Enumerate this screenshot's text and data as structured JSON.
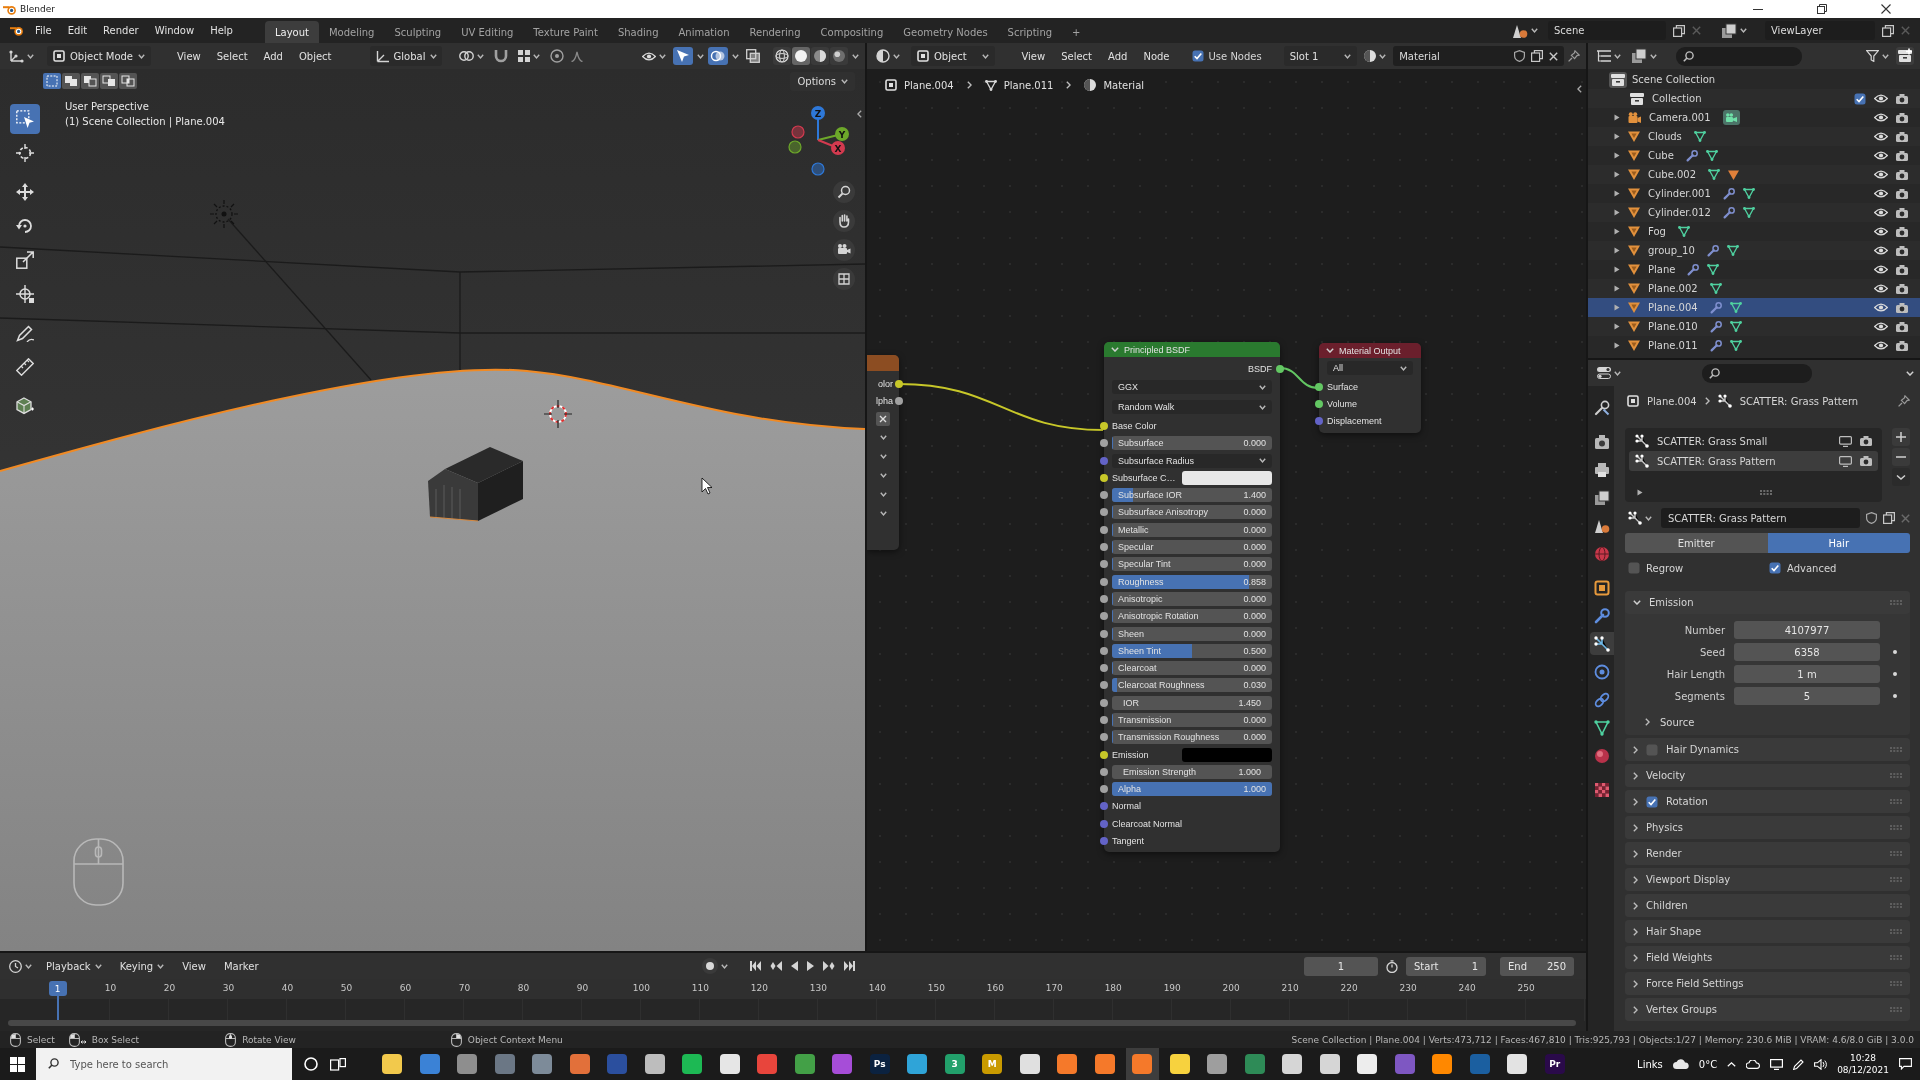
{
  "window": {
    "title": "Blender"
  },
  "topbar": {
    "menus": [
      "File",
      "Edit",
      "Render",
      "Window",
      "Help"
    ],
    "workspaces": [
      {
        "label": "Layout",
        "selected": true
      },
      {
        "label": "Modeling",
        "selected": false
      },
      {
        "label": "Sculpting",
        "selected": false
      },
      {
        "label": "UV Editing",
        "selected": false
      },
      {
        "label": "Texture Paint",
        "selected": false
      },
      {
        "label": "Shading",
        "selected": false
      },
      {
        "label": "Animation",
        "selected": false
      },
      {
        "label": "Rendering",
        "selected": false
      },
      {
        "label": "Compositing",
        "selected": false
      },
      {
        "label": "Geometry Nodes",
        "selected": false
      },
      {
        "label": "Scripting",
        "selected": false
      }
    ],
    "add_workspace": "+",
    "scene": "Scene",
    "view_layer": "ViewLayer"
  },
  "viewport": {
    "mode": "Object Mode",
    "menus": [
      "View",
      "Select",
      "Add",
      "Object"
    ],
    "orientation": "Global",
    "snap": false,
    "proportional": false,
    "gizmos": true,
    "overlays": true,
    "xray": false,
    "shading": [
      {
        "selected": false
      },
      {
        "selected": true
      },
      {
        "selected": false
      },
      {
        "selected": false
      }
    ],
    "select_modes": [
      {
        "selected": true
      },
      {
        "selected": false
      },
      {
        "selected": false
      },
      {
        "selected": false
      },
      {
        "selected": false
      }
    ],
    "options": "Options",
    "info": [
      "User Perspective",
      "(1) Scene Collection | Plane.004"
    ],
    "tools": [
      {
        "selected": true
      },
      {
        "selected": false
      },
      {
        "selected": false
      },
      {
        "selected": false
      },
      {
        "selected": false
      },
      {
        "selected": false
      },
      {
        "selected": false
      },
      {
        "selected": false
      },
      {
        "selected": false
      }
    ],
    "gizmo_axes": [
      {
        "label": "Z",
        "color": "#2e78d8"
      },
      {
        "label": "Y",
        "color": "#6da82a"
      },
      {
        "label": "X",
        "color": "#d33a4f"
      }
    ],
    "plane_selected": true
  },
  "node_editor": {
    "object": "Object",
    "menus": [
      "View",
      "Select",
      "Add",
      "Node"
    ],
    "use_nodes": {
      "label": "Use Nodes",
      "checked": true
    },
    "slot": "Slot 1",
    "material": "Material",
    "breadcrumb": [
      {
        "label": "Plane.004",
        "kind": "object"
      },
      {
        "label": "Plane.011",
        "kind": "mesh"
      },
      {
        "label": "Material",
        "kind": "material"
      }
    ],
    "texture_node": {
      "outputs": [
        {
          "label": "olor",
          "color": "#c7c729"
        },
        {
          "label": "lpha",
          "color": "#a1a1a1"
        }
      ]
    },
    "bsdf_node": {
      "title": "Principled BSDF",
      "output": {
        "label": "BSDF",
        "color": "#63c763"
      },
      "dropdowns": [
        "GGX",
        "Random Walk"
      ],
      "inputs": [
        {
          "label": "Base Color",
          "kind": "socket",
          "color": "#c7c729"
        },
        {
          "label": "Subsurface",
          "kind": "slider",
          "value": "0.000",
          "level": 0,
          "color": "#a1a1a1"
        },
        {
          "label": "Subsurface Radius",
          "kind": "menu",
          "color": "#6363c7"
        },
        {
          "label": "Subsurface C…",
          "kind": "swatch",
          "swatch": {
            "color": "#e8e8e8"
          },
          "color": "#c7c729"
        },
        {
          "label": "Subsurface IOR",
          "kind": "slider",
          "value": "1.400",
          "level": 0.13,
          "color": "#a1a1a1"
        },
        {
          "label": "Subsurface Anisotropy",
          "kind": "slider",
          "value": "0.000",
          "level": 0,
          "color": "#a1a1a1"
        },
        {
          "label": "Metallic",
          "kind": "slider",
          "value": "0.000",
          "level": 0,
          "color": "#a1a1a1"
        },
        {
          "label": "Specular",
          "kind": "slider",
          "value": "0.000",
          "level": 0,
          "color": "#a1a1a1"
        },
        {
          "label": "Specular Tint",
          "kind": "slider",
          "value": "0.000",
          "level": 0,
          "color": "#a1a1a1"
        },
        {
          "label": "Roughness",
          "kind": "slider",
          "value": "0.858",
          "level": 0.858,
          "color": "#a1a1a1"
        },
        {
          "label": "Anisotropic",
          "kind": "slider",
          "value": "0.000",
          "level": 0,
          "color": "#a1a1a1"
        },
        {
          "label": "Anisotropic Rotation",
          "kind": "slider",
          "value": "0.000",
          "level": 0,
          "color": "#a1a1a1"
        },
        {
          "label": "Sheen",
          "kind": "slider",
          "value": "0.000",
          "level": 0,
          "color": "#a1a1a1"
        },
        {
          "label": "Sheen Tint",
          "kind": "slider",
          "value": "0.500",
          "level": 0.5,
          "color": "#a1a1a1"
        },
        {
          "label": "Clearcoat",
          "kind": "slider",
          "value": "0.000",
          "level": 0,
          "color": "#a1a1a1"
        },
        {
          "label": "Clearcoat Roughness",
          "kind": "slider",
          "value": "0.030",
          "level": 0.03,
          "color": "#a1a1a1"
        },
        {
          "label": "IOR",
          "kind": "number",
          "value": "1.450",
          "color": "#a1a1a1"
        },
        {
          "label": "Transmission",
          "kind": "slider",
          "value": "0.000",
          "level": 0,
          "color": "#a1a1a1"
        },
        {
          "label": "Transmission Roughness",
          "kind": "slider",
          "value": "0.000",
          "level": 0,
          "color": "#a1a1a1"
        },
        {
          "label": "Emission",
          "kind": "swatch",
          "swatch": {
            "color": "#000000"
          },
          "color": "#c7c729"
        },
        {
          "label": "Emission Strength",
          "kind": "number",
          "value": "1.000",
          "color": "#a1a1a1"
        },
        {
          "label": "Alpha",
          "kind": "slider",
          "value": "1.000",
          "level": 1,
          "color": "#a1a1a1"
        },
        {
          "label": "Normal",
          "kind": "socket",
          "color": "#6363c7"
        },
        {
          "label": "Clearcoat Normal",
          "kind": "socket",
          "color": "#6363c7"
        },
        {
          "label": "Tangent",
          "kind": "socket",
          "color": "#6363c7"
        }
      ]
    },
    "output_node": {
      "title": "Material Output",
      "target": "All",
      "inputs": [
        {
          "label": "Surface",
          "color": "#63c763"
        },
        {
          "label": "Volume",
          "color": "#63c763"
        },
        {
          "label": "Displacement",
          "color": "#6363c7"
        }
      ]
    }
  },
  "outliner": {
    "root": "Scene Collection",
    "collection": {
      "name": "Collection",
      "checked": true
    },
    "objects": [
      {
        "name": "Camera.001",
        "kind": "camera",
        "selected": false,
        "modifier": false,
        "material": false
      },
      {
        "name": "Clouds",
        "kind": "mesh",
        "selected": false,
        "modifier": false,
        "material": false
      },
      {
        "name": "Cube",
        "kind": "mesh",
        "selected": false,
        "modifier": true,
        "material": false
      },
      {
        "name": "Cube.002",
        "kind": "mesh",
        "selected": false,
        "modifier": false,
        "material": true
      },
      {
        "name": "Cylinder.001",
        "kind": "mesh",
        "selected": false,
        "modifier": true,
        "material": false
      },
      {
        "name": "Cylinder.012",
        "kind": "mesh",
        "selected": false,
        "modifier": true,
        "material": false
      },
      {
        "name": "Fog",
        "kind": "mesh",
        "selected": false,
        "modifier": false,
        "material": false
      },
      {
        "name": "group_10",
        "kind": "mesh",
        "selected": false,
        "modifier": true,
        "material": false
      },
      {
        "name": "Plane",
        "kind": "mesh",
        "selected": false,
        "modifier": true,
        "material": false
      },
      {
        "name": "Plane.002",
        "kind": "mesh",
        "selected": false,
        "modifier": false,
        "material": false
      },
      {
        "name": "Plane.004",
        "kind": "mesh",
        "selected": true,
        "modifier": true,
        "material": false
      },
      {
        "name": "Plane.010",
        "kind": "mesh",
        "selected": false,
        "modifier": true,
        "material": false
      },
      {
        "name": "Plane.011",
        "kind": "mesh",
        "selected": false,
        "modifier": true,
        "material": false
      }
    ]
  },
  "properties": {
    "tabs": [
      {
        "selected": false
      },
      {
        "selected": false
      },
      {
        "selected": false
      },
      {
        "selected": false
      },
      {
        "selected": false
      },
      {
        "selected": false
      },
      {
        "selected": false
      },
      {
        "selected": false
      },
      {
        "selected": true
      },
      {
        "selected": false
      },
      {
        "selected": false
      },
      {
        "selected": false
      },
      {
        "selected": false
      },
      {
        "selected": false
      }
    ],
    "breadcrumb": [
      {
        "label": "Plane.004",
        "kind": "object"
      },
      {
        "label": "SCATTER: Grass Pattern",
        "kind": "particles"
      }
    ],
    "systems": [
      {
        "label": "SCATTER: Grass Small",
        "selected": false
      },
      {
        "label": "SCATTER: Grass Pattern",
        "selected": true
      }
    ],
    "settings": "SCATTER: Grass Pattern",
    "types": [
      {
        "label": "Emitter",
        "selected": false
      },
      {
        "label": "Hair",
        "selected": true
      }
    ],
    "options": [
      {
        "label": "Regrow",
        "checked": false
      },
      {
        "label": "Advanced",
        "checked": true
      }
    ],
    "emission": {
      "title": "Emission",
      "expanded": true,
      "fields": [
        {
          "label": "Number",
          "value": "4107977",
          "animatable": false
        },
        {
          "label": "Seed",
          "value": "6358",
          "animatable": true
        },
        {
          "label": "Hair Length",
          "value": "1 m",
          "animatable": true
        },
        {
          "label": "Segments",
          "value": "5",
          "animatable": true
        }
      ],
      "source": {
        "title": "Source",
        "expanded": false
      }
    },
    "panels": [
      {
        "title": "Hair Dynamics",
        "expanded": false,
        "kind": "toggle",
        "checked": false
      },
      {
        "title": "Velocity",
        "expanded": false,
        "kind": "plain"
      },
      {
        "title": "Rotation",
        "expanded": false,
        "kind": "toggle",
        "checked": true
      },
      {
        "title": "Physics",
        "expanded": false,
        "kind": "plain"
      },
      {
        "title": "Render",
        "expanded": false,
        "kind": "plain"
      },
      {
        "title": "Viewport Display",
        "expanded": false,
        "kind": "plain"
      },
      {
        "title": "Children",
        "expanded": false,
        "kind": "plain"
      },
      {
        "title": "Hair Shape",
        "expanded": false,
        "kind": "plain"
      },
      {
        "title": "Field Weights",
        "expanded": false,
        "kind": "plain"
      },
      {
        "title": "Force Field Settings",
        "expanded": false,
        "kind": "plain"
      },
      {
        "title": "Vertex Groups",
        "expanded": false,
        "kind": "plain"
      }
    ]
  },
  "timeline": {
    "menus": [
      {
        "label": "Playback",
        "dropdown": true
      },
      {
        "label": "Keying",
        "dropdown": true
      },
      {
        "label": "View",
        "dropdown": false
      },
      {
        "label": "Marker",
        "dropdown": false
      }
    ],
    "auto_keying": false,
    "current_frame": "1",
    "start": {
      "label": "Start",
      "value": "1"
    },
    "end": {
      "label": "End",
      "value": "250"
    },
    "playhead": "1",
    "ruler": [
      "10",
      "20",
      "30",
      "40",
      "50",
      "60",
      "70",
      "80",
      "90",
      "100",
      "110",
      "120",
      "130",
      "140",
      "150",
      "160",
      "170",
      "180",
      "190",
      "200",
      "210",
      "220",
      "230",
      "240",
      "250"
    ]
  },
  "status_bar": {
    "hints": [
      {
        "label": "Select",
        "kind": "left_click"
      },
      {
        "label": "Box Select",
        "kind": "drag"
      },
      {
        "label": "Rotate View",
        "kind": "middle_click"
      },
      {
        "label": "Object Context Menu",
        "kind": "right_click"
      }
    ],
    "stats": "Scene Collection | Plane.004 | Verts:473,712 | Faces:467,810 | Tris:925,793 | Objects:1/27 | Memory: 230.6 MiB | VRAM: 4.6/8.0 GiB | 3.0.0"
  },
  "taskbar": {
    "search": {
      "placeholder": "Type here to search"
    },
    "apps": [
      {
        "color": "#f2c94c",
        "selected": false
      },
      {
        "color": "#3b82d6",
        "selected": false
      },
      {
        "color": "#8e8e8e",
        "selected": false
      },
      {
        "color": "#6b7785",
        "selected": false
      },
      {
        "color": "#7d8b99",
        "selected": false
      },
      {
        "color": "#e2703a",
        "selected": false
      },
      {
        "color": "#2b4f9e",
        "selected": false
      },
      {
        "color": "#bdbdbd",
        "selected": false
      },
      {
        "color": "#1db954",
        "selected": false
      },
      {
        "color": "#e6e6e6",
        "selected": false
      },
      {
        "color": "#e8453c",
        "selected": false
      },
      {
        "color": "#43a047",
        "selected": false
      },
      {
        "color": "#a64dd8",
        "selected": false
      },
      {
        "color": "#0b2240",
        "glyph": "Ps",
        "selected": false
      },
      {
        "color": "#2fa4d8",
        "selected": false
      },
      {
        "color": "#22a06b",
        "glyph": "3",
        "selected": false
      },
      {
        "color": "#c99a00",
        "glyph": "M",
        "selected": false
      },
      {
        "color": "#e0e0e0",
        "selected": false
      },
      {
        "color": "#f5792a",
        "selected": false
      },
      {
        "color": "#f5792a",
        "selected": false
      },
      {
        "color": "#f5792a",
        "selected": true
      },
      {
        "color": "#f7d23e",
        "selected": false
      },
      {
        "color": "#9e9e9e",
        "selected": false
      },
      {
        "color": "#2e8b57",
        "selected": false
      },
      {
        "color": "#d6d6d6",
        "selected": false
      },
      {
        "color": "#d6d6d6",
        "selected": false
      },
      {
        "color": "#ededed",
        "selected": false
      },
      {
        "color": "#7e57c2",
        "selected": false
      },
      {
        "color": "#ff8800",
        "selected": false
      },
      {
        "color": "#1b5fa0",
        "selected": false
      },
      {
        "color": "#e3e3e3",
        "selected": false
      },
      {
        "color": "#2a0a4a",
        "glyph": "Pr",
        "selected": false
      }
    ],
    "links": "Links",
    "weather": "0°C",
    "time": "10:28",
    "date": "08/12/2021"
  }
}
